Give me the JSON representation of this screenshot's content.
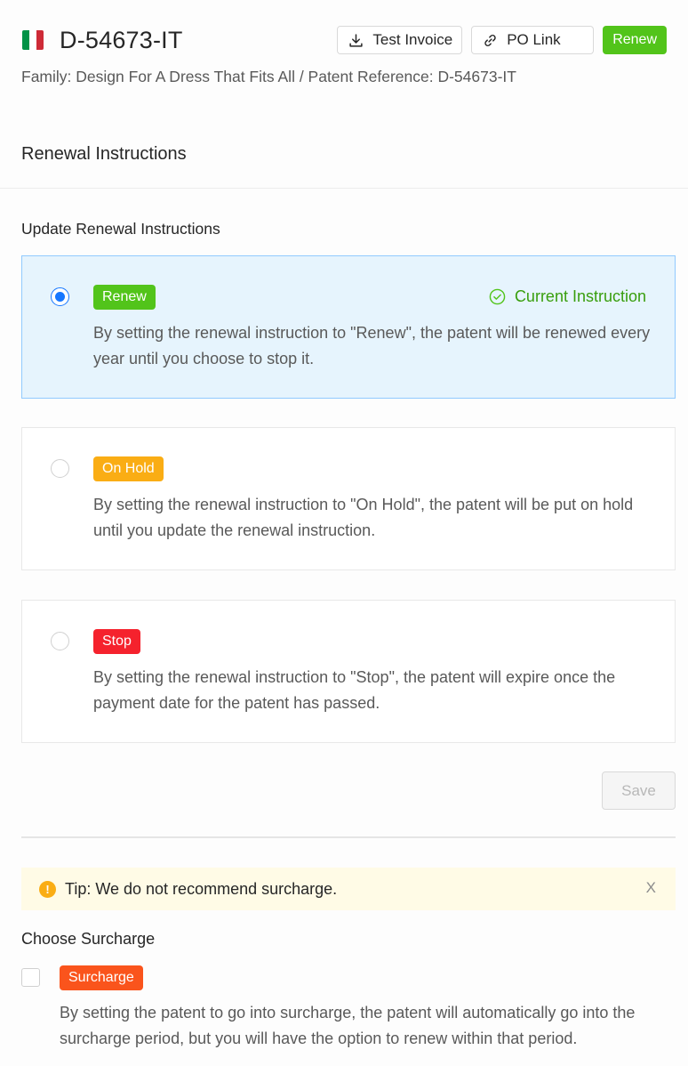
{
  "header": {
    "flag_colors": [
      "#009246",
      "#ffffff",
      "#ce2b37"
    ],
    "patent_id": "D-54673-IT",
    "test_invoice_label": "Test Invoice",
    "po_link_label": "PO Link",
    "renew_label": "Renew",
    "family_line": "Family: Design For A Dress That Fits All / Patent Reference: D-54673-IT"
  },
  "section": {
    "title": "Renewal Instructions",
    "subtitle": "Update Renewal Instructions"
  },
  "options": [
    {
      "tag": "Renew",
      "tag_color": "#52c41a",
      "selected": true,
      "current_label": "Current Instruction",
      "description": "By setting the renewal instruction to \"Renew\", the patent will be renewed every year until you choose to stop it."
    },
    {
      "tag": "On Hold",
      "tag_color": "#faad14",
      "selected": false,
      "description": "By setting the renewal instruction to \"On Hold\", the patent will be put on hold until you update the renewal instruction."
    },
    {
      "tag": "Stop",
      "tag_color": "#f5222d",
      "selected": false,
      "description": "By setting the renewal instruction to \"Stop\", the patent will expire once the payment date for the patent has passed."
    }
  ],
  "save_label": "Save",
  "tip": {
    "icon": "!",
    "text": "Tip: We do not recommend surcharge.",
    "close": "X"
  },
  "surcharge": {
    "heading": "Choose Surcharge",
    "tag": "Surcharge",
    "checked": false,
    "description": "By setting the patent to go into surcharge, the patent will automatically go into the surcharge period, but you will have the option to renew within that period."
  }
}
